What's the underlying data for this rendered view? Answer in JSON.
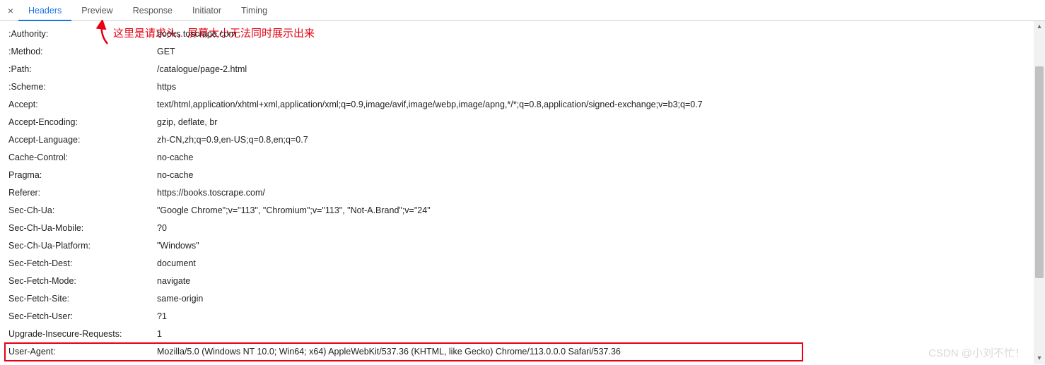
{
  "tabs": {
    "close": "×",
    "items": [
      "Headers",
      "Preview",
      "Response",
      "Initiator",
      "Timing"
    ],
    "active_index": 0
  },
  "annotation": {
    "text": "这里是请求头，屏幕太小无法同时展示出来"
  },
  "headers": [
    {
      "key": ":Authority:",
      "value": "books.toscrape.com"
    },
    {
      "key": ":Method:",
      "value": "GET"
    },
    {
      "key": ":Path:",
      "value": "/catalogue/page-2.html"
    },
    {
      "key": ":Scheme:",
      "value": "https"
    },
    {
      "key": "Accept:",
      "value": "text/html,application/xhtml+xml,application/xml;q=0.9,image/avif,image/webp,image/apng,*/*;q=0.8,application/signed-exchange;v=b3;q=0.7"
    },
    {
      "key": "Accept-Encoding:",
      "value": "gzip, deflate, br"
    },
    {
      "key": "Accept-Language:",
      "value": "zh-CN,zh;q=0.9,en-US;q=0.8,en;q=0.7"
    },
    {
      "key": "Cache-Control:",
      "value": "no-cache"
    },
    {
      "key": "Pragma:",
      "value": "no-cache"
    },
    {
      "key": "Referer:",
      "value": "https://books.toscrape.com/"
    },
    {
      "key": "Sec-Ch-Ua:",
      "value": "\"Google Chrome\";v=\"113\", \"Chromium\";v=\"113\", \"Not-A.Brand\";v=\"24\""
    },
    {
      "key": "Sec-Ch-Ua-Mobile:",
      "value": "?0"
    },
    {
      "key": "Sec-Ch-Ua-Platform:",
      "value": "\"Windows\""
    },
    {
      "key": "Sec-Fetch-Dest:",
      "value": "document"
    },
    {
      "key": "Sec-Fetch-Mode:",
      "value": "navigate"
    },
    {
      "key": "Sec-Fetch-Site:",
      "value": "same-origin"
    },
    {
      "key": "Sec-Fetch-User:",
      "value": "?1"
    },
    {
      "key": "Upgrade-Insecure-Requests:",
      "value": "1"
    },
    {
      "key": "User-Agent:",
      "value": "Mozilla/5.0 (Windows NT 10.0; Win64; x64) AppleWebKit/537.36 (KHTML, like Gecko) Chrome/113.0.0.0 Safari/537.36"
    }
  ],
  "highlight_row_index": 18,
  "watermark": "CSDN @小刘不忙！",
  "colors": {
    "accent": "#1a73e8",
    "highlight": "#e60012"
  }
}
